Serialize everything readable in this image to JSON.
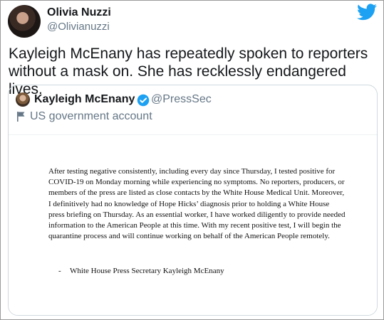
{
  "author": {
    "name": "Olivia Nuzzi",
    "handle": "@Olivianuzzi"
  },
  "tweet": {
    "text": "Kayleigh McEnany has repeatedly spoken to reporters without a mask on. She has recklessly endangered lives."
  },
  "quoted": {
    "name": "Kayleigh McEnany",
    "handle": "@PressSec",
    "label": "US government account",
    "statement": {
      "body": "After testing negative consistently, including every day since Thursday, I tested positive for COVID-19 on Monday morning while experiencing no symptoms.  No reporters, producers, or members of the press are listed as close contacts by the White House Medical Unit. Moreover, I definitively had no knowledge of Hope Hicks’ diagnosis prior to holding a White House press briefing on Thursday. As an essential worker, I have worked diligently to provide needed information to the American People at this time. With my recent positive test, I will begin the quarantine process and will continue working on behalf of the American People remotely.",
      "dash": "-",
      "signature": "White House Press Secretary Kayleigh McEnany"
    }
  },
  "icons": {
    "brand": "twitter-bird-icon",
    "verified": "verified-badge-icon",
    "label": "flag-icon"
  },
  "colors": {
    "twitter_blue": "#1da1f2",
    "secondary_text": "#657786",
    "border": "#cfd9de"
  }
}
